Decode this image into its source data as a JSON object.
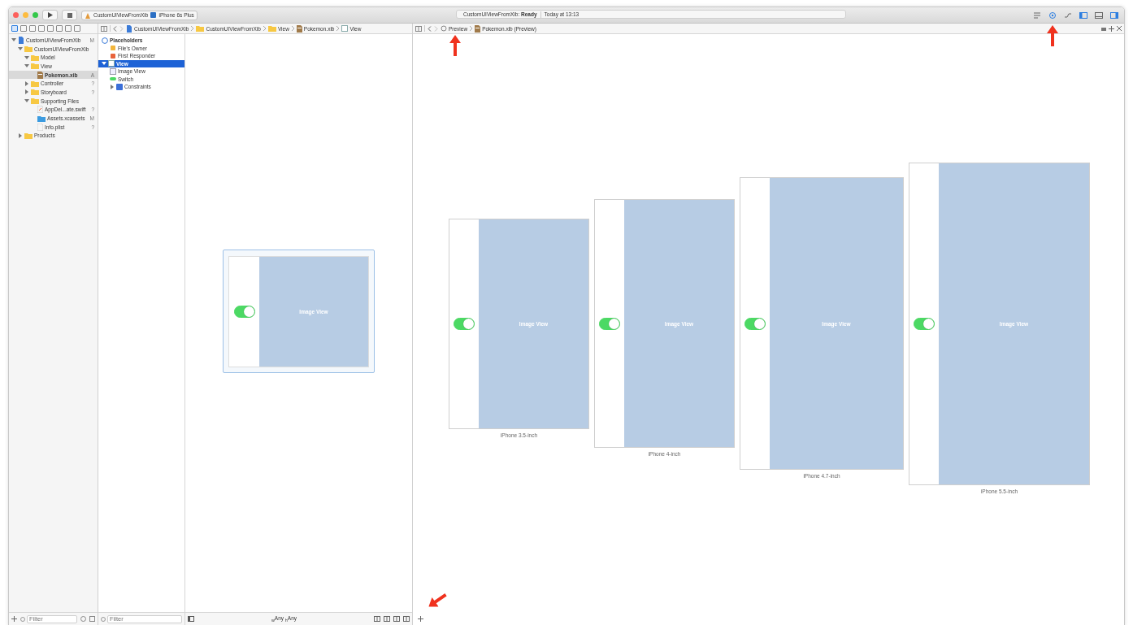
{
  "window": {
    "controls": [
      {
        "color": "#fc605c"
      },
      {
        "color": "#fdbc40"
      },
      {
        "color": "#34c84a"
      }
    ],
    "scheme": "CustomUIViewFromXib",
    "destination": "iPhone 6s Plus",
    "status": "CustomUIViewFromXib: **Ready**",
    "time": "Today at 13:13"
  },
  "toolbar_right": [
    {
      "kind": "editor-standard"
    },
    {
      "kind": "editor-assistant",
      "annotated": true
    },
    {
      "kind": "editor-version"
    },
    {
      "kind": "panel-left"
    },
    {
      "kind": "panel-bottom"
    },
    {
      "kind": "panel-right"
    }
  ],
  "navigator": {
    "tabs": [
      {
        "selected": true
      },
      {
        "selected": false
      },
      {
        "selected": false
      },
      {
        "selected": false
      },
      {
        "selected": false
      },
      {
        "selected": false
      },
      {
        "selected": false
      },
      {
        "selected": false
      }
    ],
    "tree": [
      {
        "label": "CustomUIViewFromXib",
        "kind": "project",
        "badge": "M",
        "expanded": true,
        "selected": false,
        "children": [
          {
            "label": "CustomUIViewFromXib",
            "kind": "folder",
            "expanded": true,
            "selected": false,
            "children": [
              {
                "label": "Model",
                "kind": "folder",
                "expanded": true,
                "selected": false
              },
              {
                "label": "View",
                "kind": "folder",
                "expanded": true,
                "selected": false,
                "children": [
                  {
                    "label": "Pokemon.xib",
                    "kind": "xib",
                    "badge": "A",
                    "selected": true
                  }
                ]
              },
              {
                "label": "Controller",
                "kind": "folder",
                "badge": "?",
                "expanded": false,
                "selected": false
              },
              {
                "label": "Storyboard",
                "kind": "folder",
                "badge": "?",
                "expanded": false,
                "selected": false
              },
              {
                "label": "Supporting Files",
                "kind": "folder",
                "expanded": true,
                "selected": false,
                "children": [
                  {
                    "label": "AppDel...ate.swift",
                    "kind": "swift",
                    "badge": "?",
                    "selected": false
                  },
                  {
                    "label": "Assets.xcassets",
                    "kind": "assets",
                    "badge": "M",
                    "selected": false
                  },
                  {
                    "label": "Info.plist",
                    "kind": "plist",
                    "badge": "?",
                    "selected": false
                  }
                ]
              }
            ]
          },
          {
            "label": "Products",
            "kind": "folder",
            "expanded": false,
            "selected": false
          }
        ]
      }
    ],
    "filter_placeholder": "Filter"
  },
  "editor": {
    "breadcrumbs": [
      {
        "label": "CustomUIViewFromXib",
        "kind": "project"
      },
      {
        "label": "CustomUIViewFromXib",
        "kind": "folder"
      },
      {
        "label": "View",
        "kind": "folder"
      },
      {
        "label": "Pokemon.xib",
        "kind": "xib"
      },
      {
        "label": "View",
        "kind": "view"
      }
    ],
    "outline": [
      {
        "label": "Placeholders",
        "kind": "section",
        "children": [
          {
            "label": "File's Owner",
            "kind": "owner",
            "selected": false
          },
          {
            "label": "First Responder",
            "kind": "responder",
            "selected": false
          }
        ]
      },
      {
        "label": "View",
        "kind": "view",
        "expanded": true,
        "selected": true,
        "children": [
          {
            "label": "Image View",
            "kind": "imageview",
            "selected": false
          },
          {
            "label": "Switch",
            "kind": "switch",
            "selected": false
          },
          {
            "label": "Constraints",
            "kind": "constraints",
            "expanded": false,
            "selected": false
          }
        ]
      }
    ],
    "outline_filter_placeholder": "Filter",
    "canvas": {
      "switch_on": true,
      "image_label": "Image View"
    },
    "size_class": "$_{w}$Any $_{h}$Any"
  },
  "preview": {
    "breadcrumbs": [
      {
        "label": "Preview",
        "kind": "preview",
        "annotated": true
      },
      {
        "label": "Pokemon.xib (Preview)",
        "kind": "xib"
      }
    ],
    "devices": [
      {
        "name": "iPhone 3.5-inch",
        "switch_on": true,
        "image_label": "Image View"
      },
      {
        "name": "iPhone 4-inch",
        "switch_on": true,
        "image_label": "Image View"
      },
      {
        "name": "iPhone 4.7-inch",
        "switch_on": true,
        "image_label": "Image View"
      },
      {
        "name": "iPhone 5.5-inch",
        "switch_on": true,
        "image_label": "Image View"
      }
    ],
    "add_annotated": true
  }
}
